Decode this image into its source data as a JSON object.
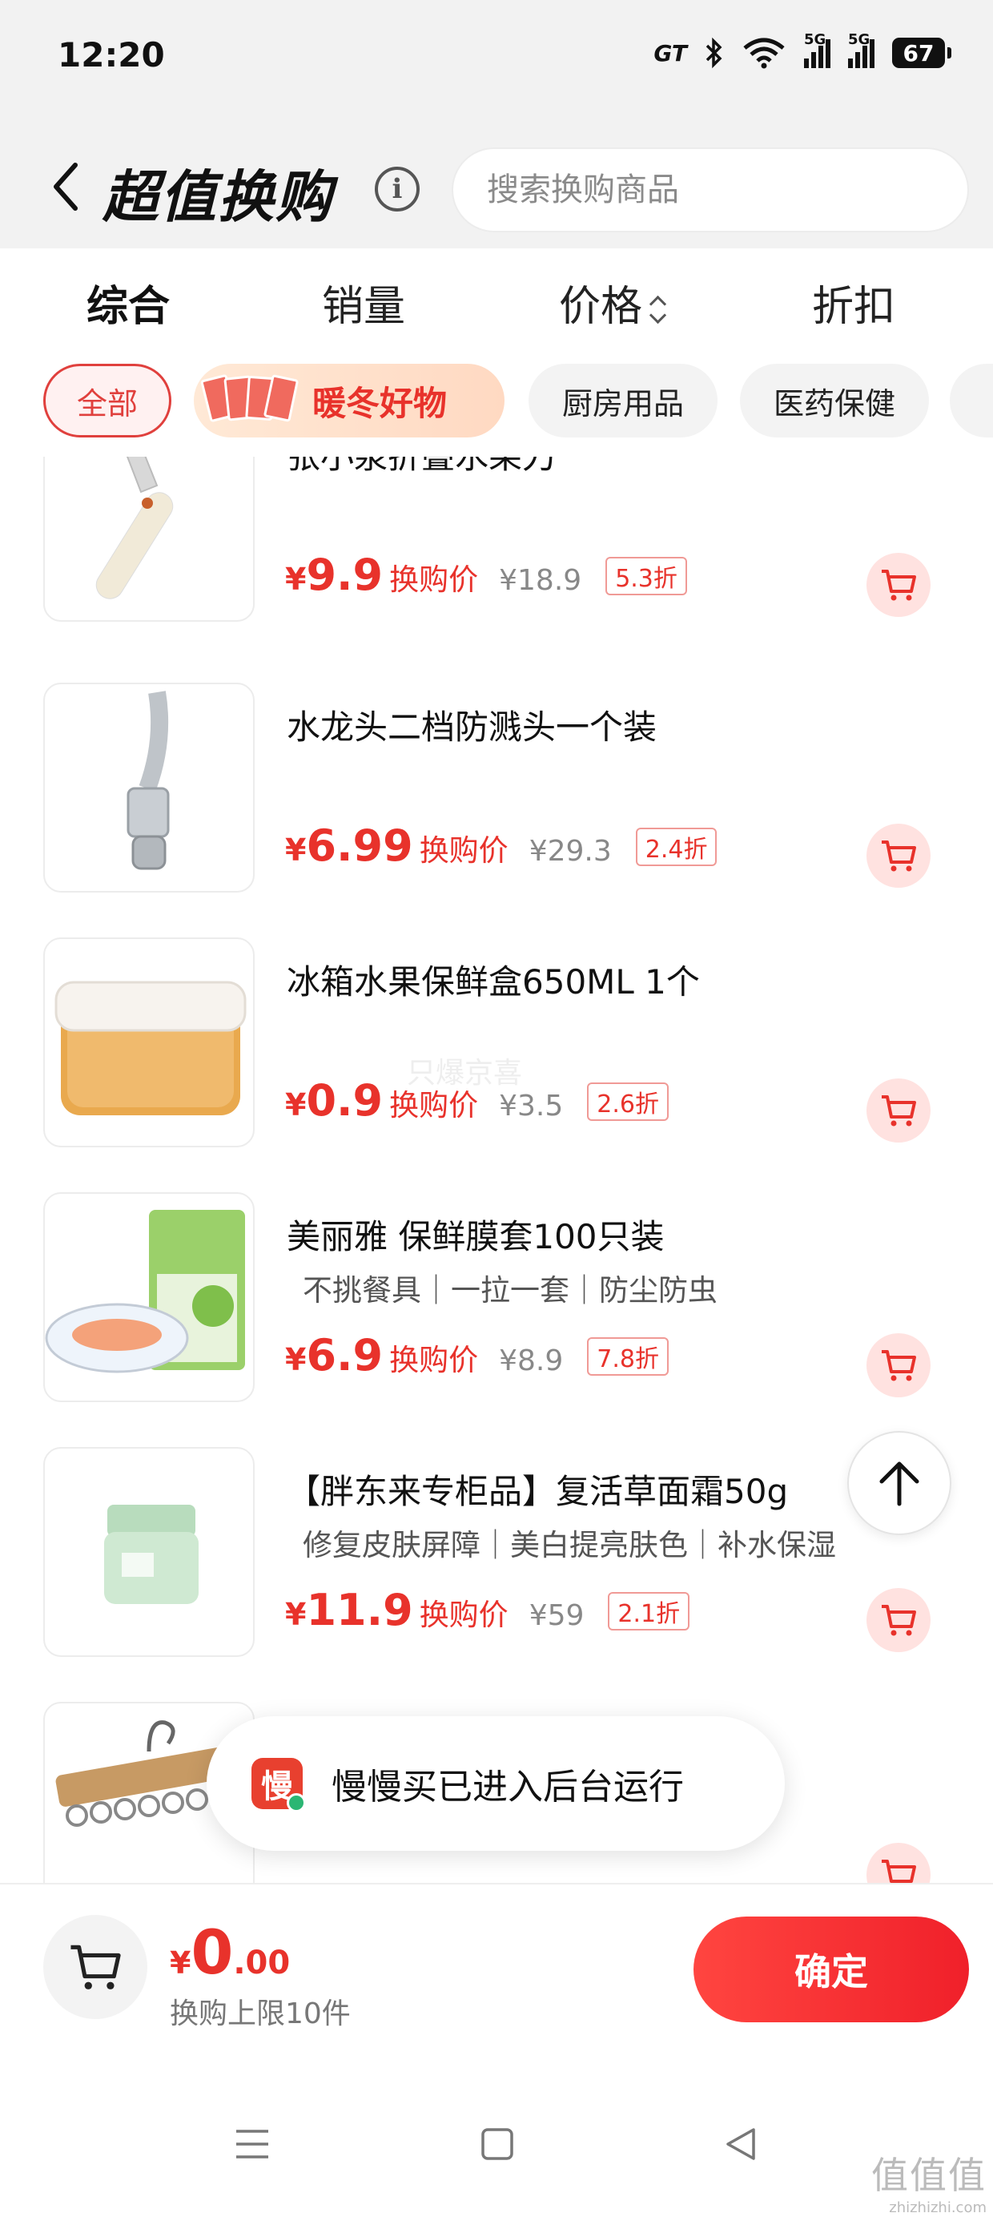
{
  "status_bar": {
    "time": "12:20",
    "carrier_mark": "GT",
    "network_1": "5G",
    "network_2": "5G",
    "battery": "67",
    "icons": [
      "bluetooth-icon",
      "wifi-icon",
      "signal-icon",
      "battery-icon"
    ]
  },
  "header": {
    "title": "超值换购",
    "info_icon": "info-icon",
    "search_placeholder": "搜索换购商品"
  },
  "sort_tabs": [
    {
      "label": "综合",
      "active": true
    },
    {
      "label": "销量",
      "active": false
    },
    {
      "label": "价格",
      "active": false
    },
    {
      "label": "折扣",
      "active": false
    }
  ],
  "categories": {
    "all": "全部",
    "promo": "暖冬好物",
    "kitchen": "厨房用品",
    "health": "医药保健"
  },
  "products": [
    {
      "name": "张小泉折叠水果刀",
      "tags": "",
      "price": "9.9",
      "price_label": "换购价",
      "original": "¥18.9",
      "discount": "5.3折"
    },
    {
      "name": "水龙头二档防溅头一个装",
      "tags": "",
      "price": "6.99",
      "price_label": "换购价",
      "original": "¥29.3",
      "discount": "2.4折"
    },
    {
      "name": "冰箱水果保鲜盒650ML 1个",
      "tags": "",
      "price": "0.9",
      "price_label": "换购价",
      "original": "¥3.5",
      "discount": "2.6折"
    },
    {
      "name": "美丽雅 保鲜膜套100只装",
      "tags": "不挑餐具｜一拉一套｜防尘防虫",
      "price": "6.9",
      "price_label": "换购价",
      "original": "¥8.9",
      "discount": "7.8折"
    },
    {
      "name": "【胖东来专柜品】复活草面霜50g",
      "tags": "修复皮肤屏障｜美白提亮肤色｜补水保湿",
      "price": "11.9",
      "price_label": "换购价",
      "original": "¥59",
      "discount": "2.1折"
    }
  ],
  "currency": "¥",
  "toast": {
    "icon_char": "慢",
    "text": "慢慢买已进入后台运行"
  },
  "bottom_bar": {
    "total_int": "0",
    "total_dec": ".00",
    "limit": "换购上限10件",
    "confirm": "确定"
  },
  "ghost_watermark": "只爆京喜",
  "watermark": {
    "big": "值值值",
    "small": "zhizhizhi.com"
  },
  "colors": {
    "accent": "#e8322b",
    "header_bg": "#f2f2f2",
    "cart_bg": "#ffe2e0"
  }
}
